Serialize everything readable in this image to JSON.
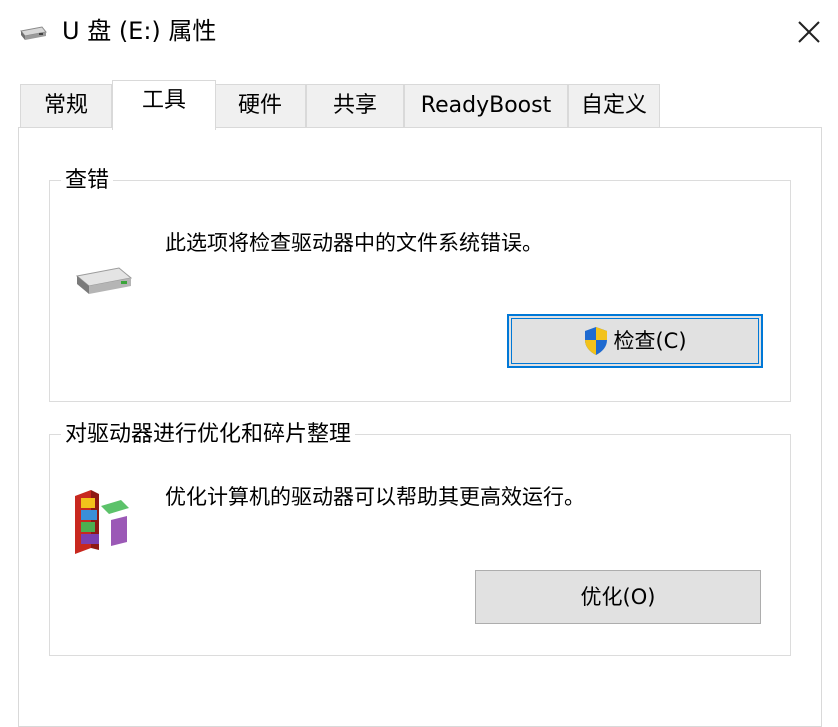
{
  "window": {
    "title": "U 盘 (E:) 属性",
    "icons": {
      "title": "usb-drive-icon",
      "close": "close-icon"
    }
  },
  "tabs": [
    {
      "label": "常规",
      "active": false
    },
    {
      "label": "工具",
      "active": true
    },
    {
      "label": "硬件",
      "active": false
    },
    {
      "label": "共享",
      "active": false
    },
    {
      "label": "ReadyBoost",
      "active": false
    },
    {
      "label": "自定义",
      "active": false
    }
  ],
  "error_check": {
    "group_title": "查错",
    "description": "此选项将检查驱动器中的文件系统错误。",
    "button_label": "检查(C)",
    "icons": {
      "drive": "hard-drive-icon",
      "button": "uac-shield-icon"
    }
  },
  "optimize": {
    "group_title": "对驱动器进行优化和碎片整理",
    "description": "优化计算机的驱动器可以帮助其更高效运行。",
    "button_label": "优化(O)",
    "icons": {
      "drive": "defrag-blocks-icon"
    }
  },
  "colors": {
    "accent_border": "#0078d7",
    "button_face": "#e1e1e1",
    "tab_inactive": "#f0f0f0"
  }
}
